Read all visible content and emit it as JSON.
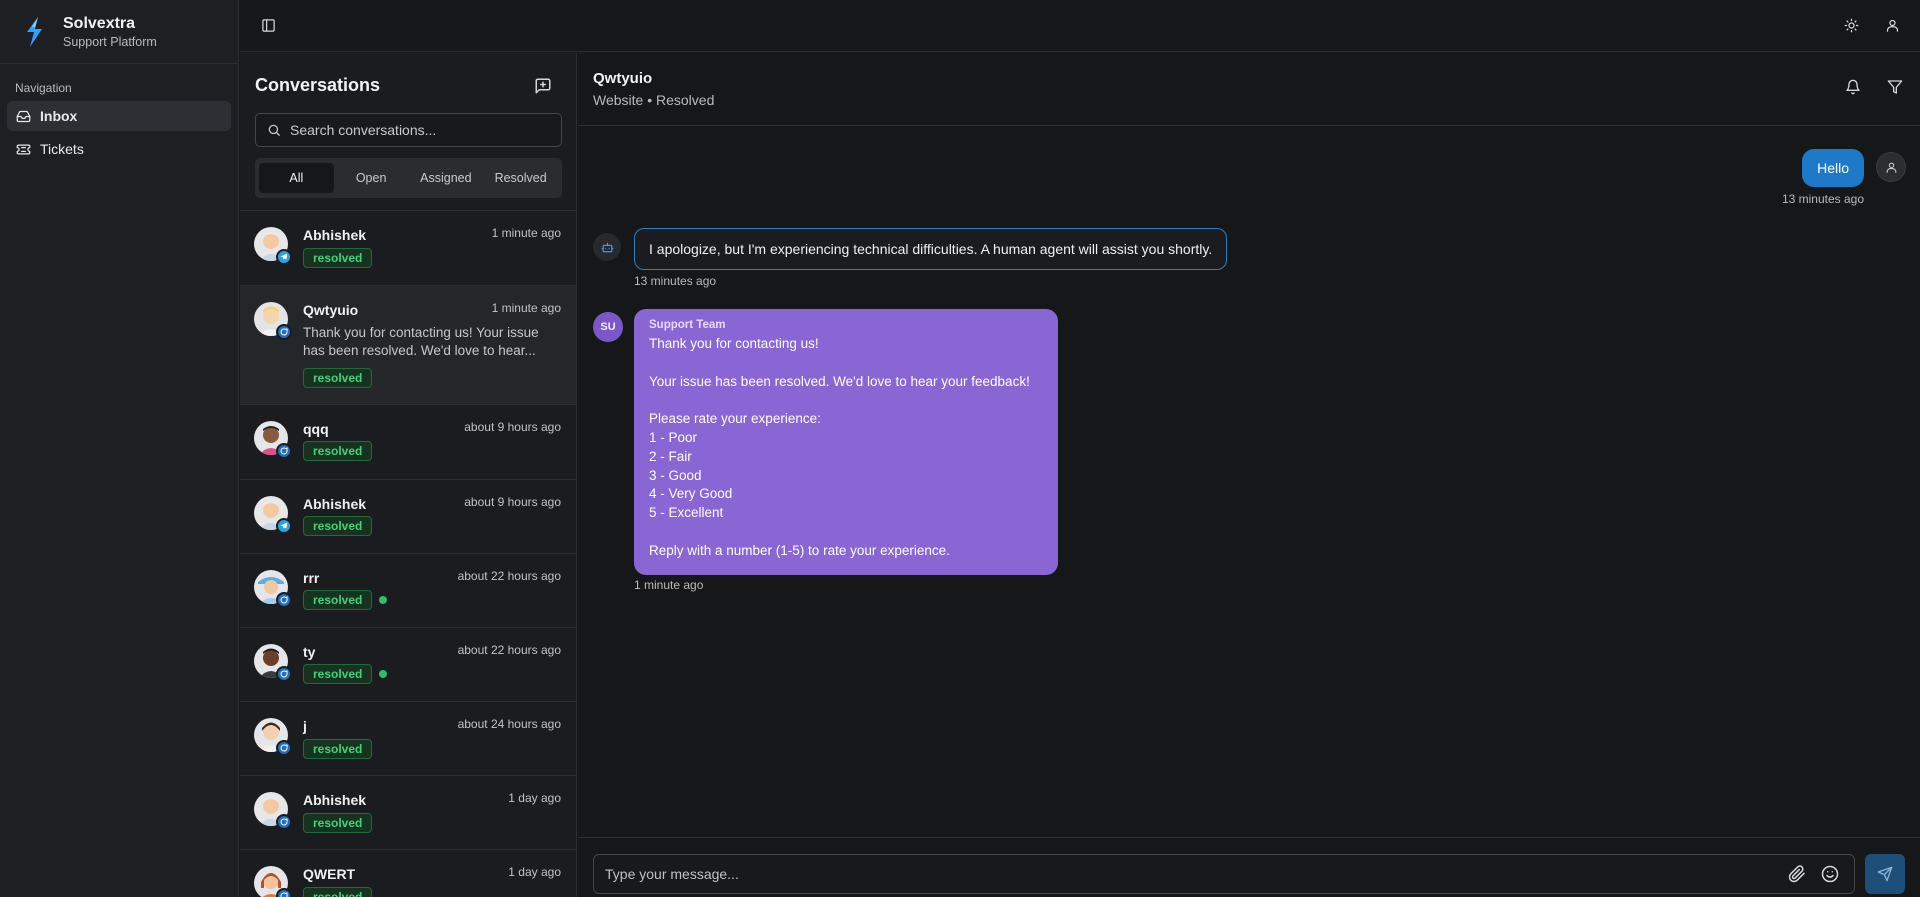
{
  "brand": {
    "name": "Solvextra",
    "subtitle": "Support Platform"
  },
  "sidebar": {
    "caption": "Navigation",
    "items": [
      {
        "label": "Inbox",
        "icon": "inbox-icon",
        "active": true
      },
      {
        "label": "Tickets",
        "icon": "ticket-icon",
        "active": false
      }
    ]
  },
  "conversations": {
    "title": "Conversations",
    "search_placeholder": "Search conversations...",
    "tabs": [
      "All",
      "Open",
      "Assigned",
      "Resolved"
    ],
    "active_tab": "All",
    "items": [
      {
        "name": "Abhishek",
        "time": "1 minute ago",
        "status": "resolved",
        "channel": "telegram",
        "preview": ""
      },
      {
        "name": "Qwtyuio",
        "time": "1 minute ago",
        "status": "resolved",
        "channel": "website",
        "selected": true,
        "preview": "Thank you for contacting us! Your issue has been resolved. We'd love to hear..."
      },
      {
        "name": "qqq",
        "time": "about 9 hours ago",
        "status": "resolved",
        "channel": "website",
        "preview": ""
      },
      {
        "name": "Abhishek",
        "time": "about 9 hours ago",
        "status": "resolved",
        "channel": "telegram",
        "preview": ""
      },
      {
        "name": "rrr",
        "time": "about 22 hours ago",
        "status": "resolved",
        "channel": "website",
        "online": true,
        "preview": ""
      },
      {
        "name": "ty",
        "time": "about 22 hours ago",
        "status": "resolved",
        "channel": "website",
        "online": true,
        "preview": ""
      },
      {
        "name": "j",
        "time": "about 24 hours ago",
        "status": "resolved",
        "channel": "website",
        "preview": ""
      },
      {
        "name": "Abhishek",
        "time": "1 day ago",
        "status": "resolved",
        "channel": "website",
        "preview": ""
      },
      {
        "name": "QWERT",
        "time": "1 day ago",
        "status": "resolved",
        "channel": "website",
        "preview": ""
      }
    ]
  },
  "chat": {
    "contact_name": "Qwtyuio",
    "contact_meta": "Website • Resolved",
    "messages": {
      "user": {
        "text": "Hello",
        "time": "13 minutes ago"
      },
      "bot": {
        "text": "I apologize, but I'm experiencing technical difficulties. A human agent will assist you shortly.",
        "time": "13 minutes ago"
      },
      "support": {
        "initials": "SU",
        "sender": "Support Team",
        "text": "Thank you for contacting us!\n\nYour issue has been resolved. We'd love to hear your feedback!\n\nPlease rate your experience:\n1 - Poor\n2 - Fair\n3 - Good\n4 - Very Good\n5 - Excellent\n\nReply with a number (1-5) to rate your experience.",
        "time": "1 minute ago"
      }
    },
    "composer_placeholder": "Type your message..."
  },
  "colors": {
    "accent_blue": "#1e7ac9",
    "support_purple": "#8a66d4",
    "resolved_green": "#3fd37a",
    "telegram_blue": "#2aa3e0",
    "website_blue": "#1f6fbf"
  }
}
